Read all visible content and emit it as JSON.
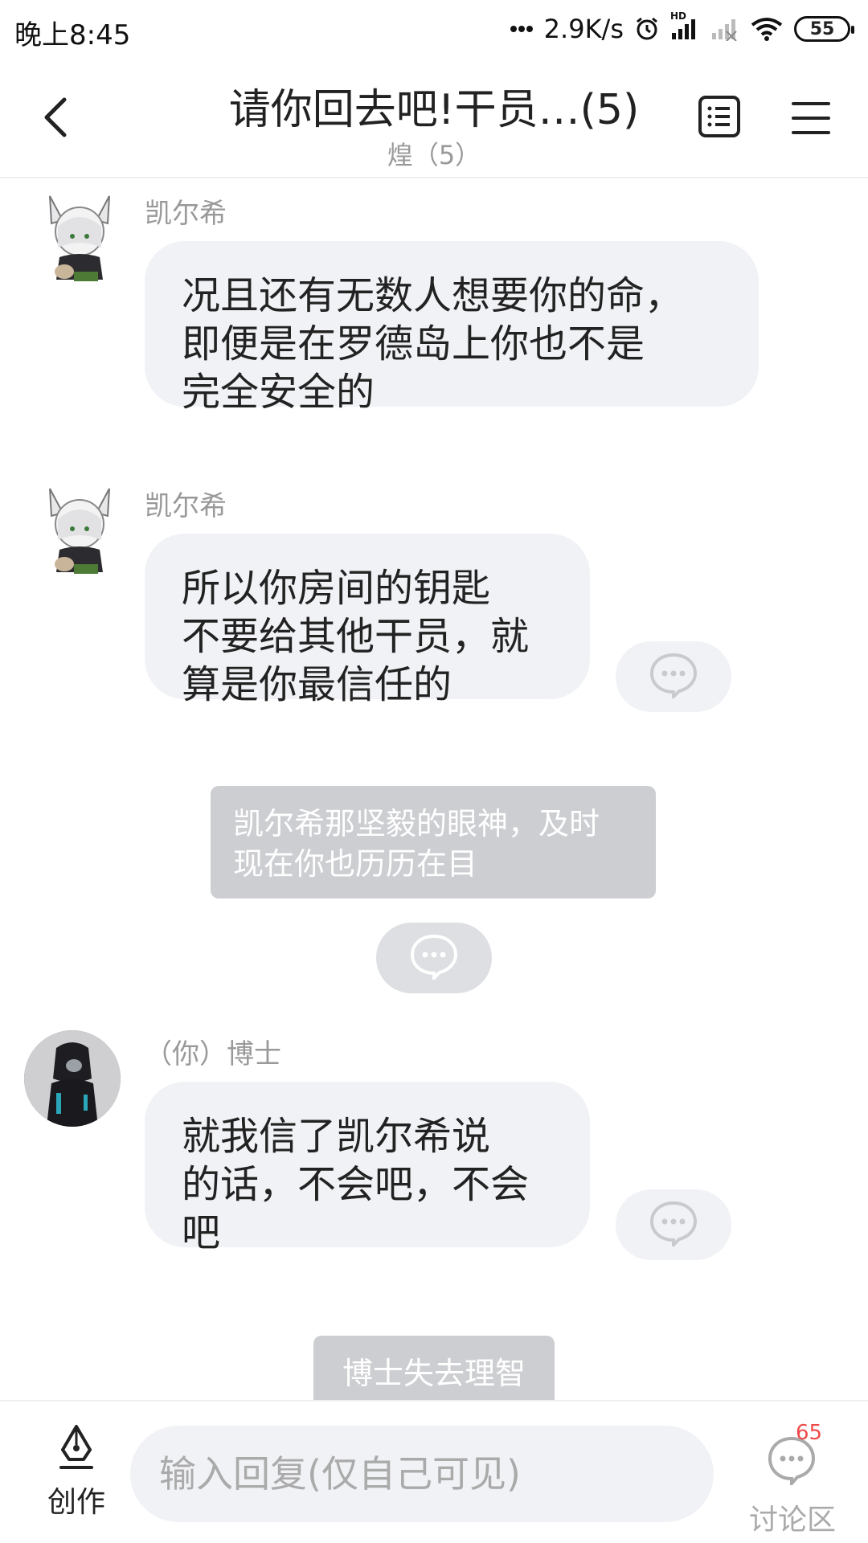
{
  "status_bar": {
    "time": "晚上8:45",
    "net_speed": "2.9K/s",
    "network_badge": "HD",
    "battery": "55"
  },
  "header": {
    "title": "请你回去吧!干员…(5)",
    "subtitle": "煌（5）"
  },
  "messages": [
    {
      "sender": "凯尔希",
      "lines": [
        "况且还有无数人想要你的命，",
        "即便是在罗德岛上你也不是",
        "完全安全的"
      ]
    },
    {
      "sender": "凯尔希",
      "lines": [
        "所以你房间的钥匙",
        "不要给其他干员，就",
        "算是你最信任的"
      ]
    },
    {
      "sender": "（你）博士",
      "lines": [
        "就我信了凯尔希说",
        "的话，不会吧，不会",
        "吧"
      ]
    }
  ],
  "narrations": [
    {
      "lines": [
        "凯尔希那坚毅的眼神，及时",
        "现在你也历历在目"
      ]
    },
    {
      "lines": [
        "博士失去理智"
      ]
    }
  ],
  "bottom_bar": {
    "create_label": "创作",
    "reply_placeholder": "输入回复(仅自己可见)",
    "discuss_badge": "65",
    "discuss_label": "讨论区"
  },
  "colors": {
    "bubble_bg": "#f1f2f6",
    "narration_bg": "#cdced2",
    "badge_red": "#ee4a4a",
    "muted_text": "#999999"
  }
}
